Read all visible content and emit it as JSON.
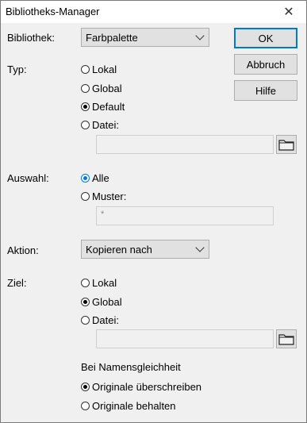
{
  "window": {
    "title": "Bibliotheks-Manager",
    "close_glyph": "✕"
  },
  "library": {
    "label": "Bibliothek:",
    "selected": "Farbpalette"
  },
  "buttons": {
    "ok": "OK",
    "cancel": "Abbruch",
    "help": "Hilfe"
  },
  "type": {
    "label": "Typ:",
    "options": [
      "Lokal",
      "Global",
      "Default",
      "Datei:"
    ],
    "selected": "Default",
    "file_value": ""
  },
  "selection": {
    "label": "Auswahl:",
    "options": [
      "Alle",
      "Muster:"
    ],
    "selected": "Alle",
    "pattern_value": "*"
  },
  "action": {
    "label": "Aktion:",
    "selected": "Kopieren nach"
  },
  "target": {
    "label": "Ziel:",
    "options": [
      "Lokal",
      "Global",
      "Datei:"
    ],
    "selected": "Global",
    "file_value": ""
  },
  "name_conflict": {
    "heading": "Bei Namensgleichheit",
    "options": [
      "Originale überschreiben",
      "Originale behalten"
    ],
    "selected": "Originale überschreiben"
  },
  "icons": {
    "close": "close-icon",
    "dropdown": "chevron-down-icon",
    "folder": "folder-icon"
  }
}
